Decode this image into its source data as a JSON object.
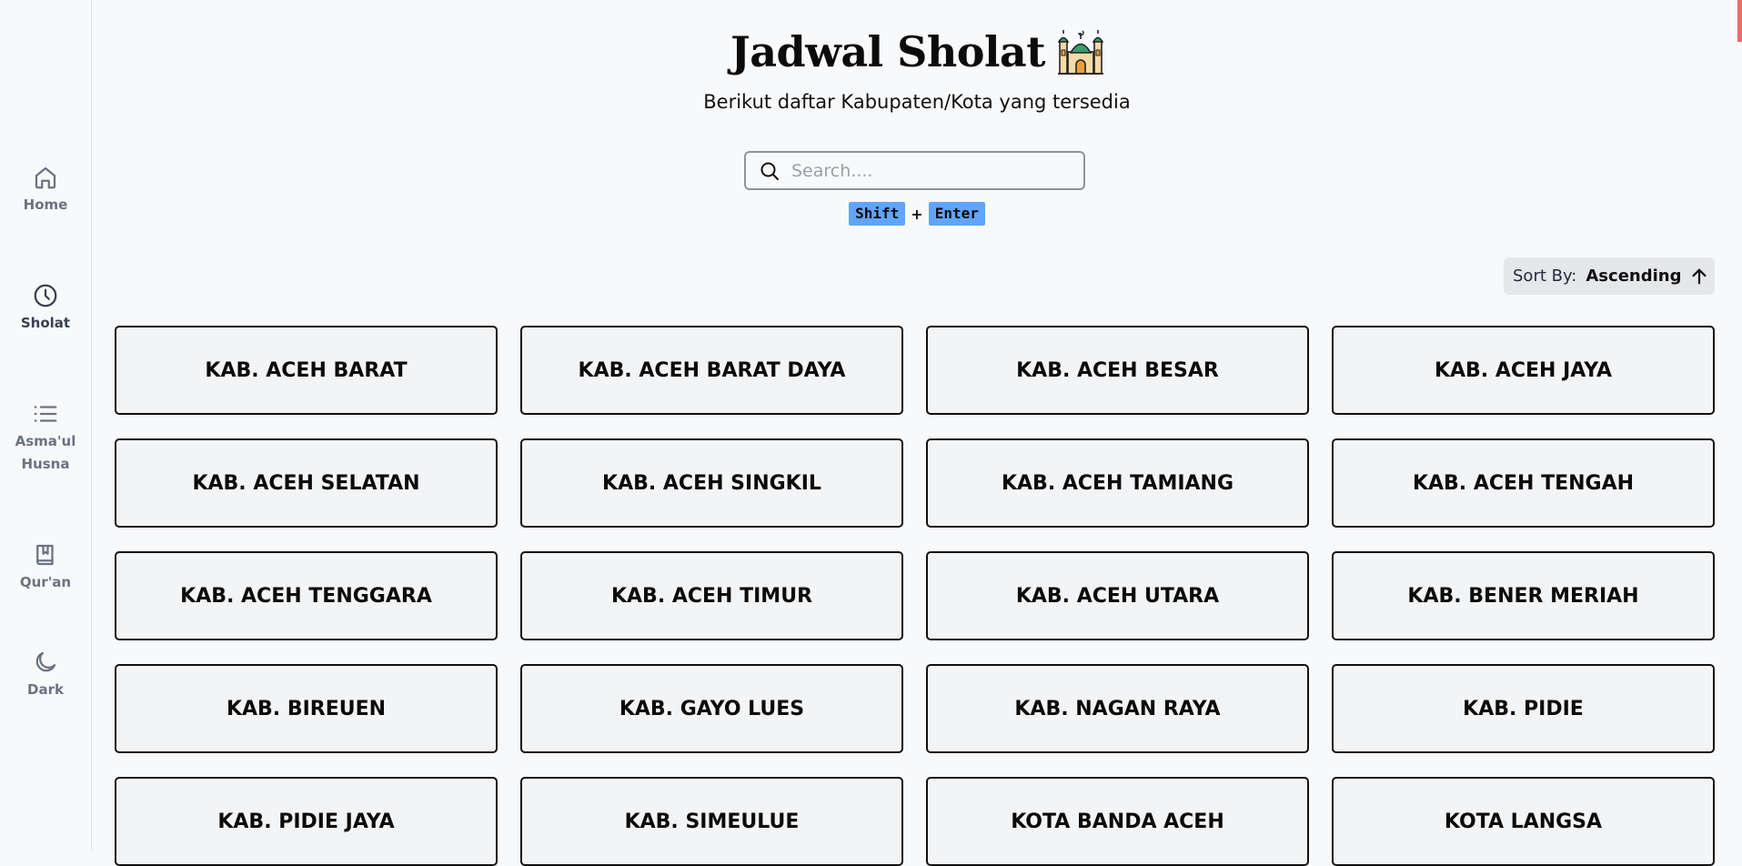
{
  "sidebar": {
    "items": [
      {
        "label": "Home",
        "icon": "home-icon"
      },
      {
        "label": "Sholat",
        "icon": "clock-icon",
        "active": true
      },
      {
        "label": "Asma'ul Husna",
        "icon": "list-icon"
      },
      {
        "label": "Qur'an",
        "icon": "book-icon"
      },
      {
        "label": "Dark",
        "icon": "moon-icon"
      }
    ]
  },
  "header": {
    "title": "Jadwal Sholat",
    "title_emoji": "🕌",
    "subtitle": "Berikut daftar Kabupaten/Kota yang tersedia"
  },
  "search": {
    "placeholder": "Search....",
    "value": ""
  },
  "shortcut": {
    "key1": "Shift",
    "plus": "+",
    "key2": "Enter"
  },
  "sort": {
    "label": "Sort By:",
    "value": "Ascending"
  },
  "regions": [
    "KAB. ACEH BARAT",
    "KAB. ACEH BARAT DAYA",
    "KAB. ACEH BESAR",
    "KAB. ACEH JAYA",
    "KAB. ACEH SELATAN",
    "KAB. ACEH SINGKIL",
    "KAB. ACEH TAMIANG",
    "KAB. ACEH TENGAH",
    "KAB. ACEH TENGGARA",
    "KAB. ACEH TIMUR",
    "KAB. ACEH UTARA",
    "KAB. BENER MERIAH",
    "KAB. BIREUEN",
    "KAB. GAYO LUES",
    "KAB. NAGAN RAYA",
    "KAB. PIDIE",
    "KAB. PIDIE JAYA",
    "KAB. SIMEULUE",
    "KOTA BANDA ACEH",
    "KOTA LANGSA"
  ],
  "colors": {
    "accent": "#60a5fa",
    "card_bg": "#f3f4f6",
    "page_bg": "#f8f9fb",
    "scroll_marker": "#ef6b6b"
  }
}
